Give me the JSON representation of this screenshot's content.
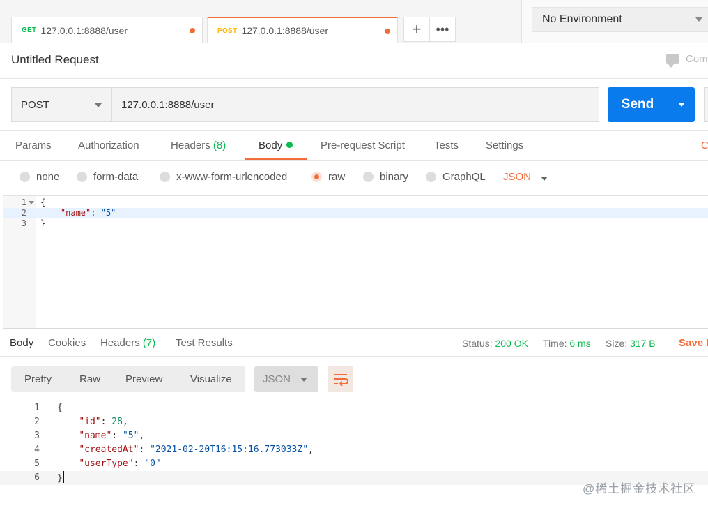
{
  "tabs": [
    {
      "method": "GET",
      "url": "127.0.0.1:8888/user"
    },
    {
      "method": "POST",
      "url": "127.0.0.1:8888/user"
    }
  ],
  "environment": {
    "selected": "No Environment"
  },
  "request": {
    "title": "Untitled Request",
    "comments_label": "Com",
    "method": "POST",
    "url": "127.0.0.1:8888/user",
    "send_label": "Send"
  },
  "request_tabs": {
    "params": "Params",
    "authorization": "Authorization",
    "headers": "Headers",
    "headers_count": "(8)",
    "body": "Body",
    "prerequest": "Pre-request Script",
    "tests": "Tests",
    "settings": "Settings",
    "cookies_stub": "C"
  },
  "body_modes": {
    "none": "none",
    "form_data": "form-data",
    "urlencoded": "x-www-form-urlencoded",
    "raw": "raw",
    "binary": "binary",
    "graphql": "GraphQL",
    "format": "JSON"
  },
  "request_body": {
    "line_numbers": [
      "1",
      "2",
      "3"
    ],
    "open": "{",
    "key": "\"name\"",
    "colon": ": ",
    "value": "\"5\"",
    "close": "}"
  },
  "response": {
    "tabs": {
      "body": "Body",
      "cookies": "Cookies",
      "headers": "Headers",
      "headers_count": "(7)",
      "test_results": "Test Results"
    },
    "status_label": "Status:",
    "status_value": "200 OK",
    "time_label": "Time:",
    "time_value": "6 ms",
    "size_label": "Size:",
    "size_value": "317 B",
    "save_label": "Save R",
    "views": {
      "pretty": "Pretty",
      "raw": "Raw",
      "preview": "Preview",
      "visualize": "Visualize"
    },
    "format": "JSON",
    "line_numbers": [
      "1",
      "2",
      "3",
      "4",
      "5",
      "6"
    ],
    "body": {
      "open": "{",
      "id_key": "\"id\"",
      "id_value": "28",
      "name_key": "\"name\"",
      "name_value": "\"5\"",
      "created_key": "\"createdAt\"",
      "created_value": "\"2021-02-20T16:15:16.773033Z\"",
      "usertype_key": "\"userType\"",
      "usertype_value": "\"0\"",
      "close": "}"
    }
  },
  "watermark": "@稀土掘金技术社区",
  "colors": {
    "accent": "#f26b3a",
    "send": "#097bed",
    "success": "#0cbb52"
  }
}
